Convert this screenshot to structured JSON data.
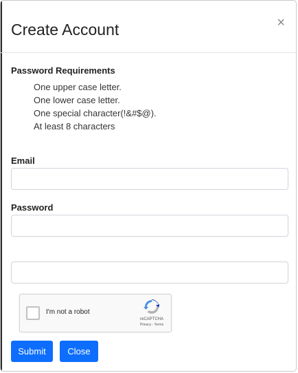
{
  "modal": {
    "title": "Create Account",
    "close_symbol": "×"
  },
  "requirements": {
    "heading": "Password Requirements",
    "items": [
      "One upper case letter.",
      "One lower case letter.",
      "One special character(!&#$@).",
      "At least 8 characters"
    ]
  },
  "form": {
    "email_label": "Email",
    "email_value": "",
    "password_label": "Password",
    "password_value": "",
    "confirm_value": ""
  },
  "recaptcha": {
    "label": "I'm not a robot",
    "brand": "reCAPTCHA",
    "links": "Privacy - Terms",
    "icon": "recaptcha-logo-icon"
  },
  "buttons": {
    "submit_label": "Submit",
    "close_label": "Close"
  },
  "colors": {
    "primary": "#0d6efd",
    "recaptcha_blue": "#1c3aa9",
    "recaptcha_light": "#4a90e2",
    "recaptcha_gray": "#b3b3b3"
  }
}
